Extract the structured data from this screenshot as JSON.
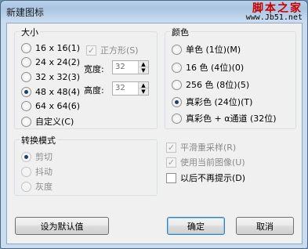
{
  "window": {
    "title": "新建图标"
  },
  "watermark": {
    "site_name": "脚本之家",
    "site_url": "www.Jb51.net"
  },
  "size_group": {
    "label": "大小",
    "options": [
      {
        "label": "16 x 16(1)",
        "selected": false
      },
      {
        "label": "24 x 24(2)",
        "selected": false
      },
      {
        "label": "32 x 32(3)",
        "selected": false
      },
      {
        "label": "48 x 48(4)",
        "selected": true
      },
      {
        "label": "64 x 64(6)",
        "selected": false
      },
      {
        "label": "自定义(C)",
        "selected": false
      }
    ],
    "square_label": "正方形(S)",
    "square_checked": true,
    "width_label": "宽度:",
    "width_value": "32",
    "height_label": "高度:",
    "height_value": "32"
  },
  "color_group": {
    "label": "颜色",
    "options": [
      {
        "label": "单色 (1位)(M)",
        "selected": false
      },
      {
        "label": "16 色 (4位)(0)",
        "selected": false
      },
      {
        "label": "256 色 (8位)(5)",
        "selected": false
      },
      {
        "label": "真彩色 (24位)(T)",
        "selected": true
      },
      {
        "label": "真彩色 + α通道 (32位)",
        "selected": false
      }
    ]
  },
  "mode_group": {
    "label": "转换模式",
    "options": [
      {
        "label": "剪切",
        "selected": true
      },
      {
        "label": "抖动",
        "selected": false
      },
      {
        "label": "灰度",
        "selected": false
      }
    ]
  },
  "checkboxes": [
    {
      "label": "平滑重采样(R)",
      "checked": true,
      "disabled": true
    },
    {
      "label": "使用当前图像(U)",
      "checked": true,
      "disabled": true
    },
    {
      "label": "以后不再提示(D)",
      "checked": false,
      "disabled": false
    }
  ],
  "buttons": {
    "set_default": "设为默认值",
    "ok": "确定",
    "cancel": "取消"
  },
  "icons": {
    "check": "✓",
    "spin_up": "▲",
    "spin_down": "▼"
  }
}
